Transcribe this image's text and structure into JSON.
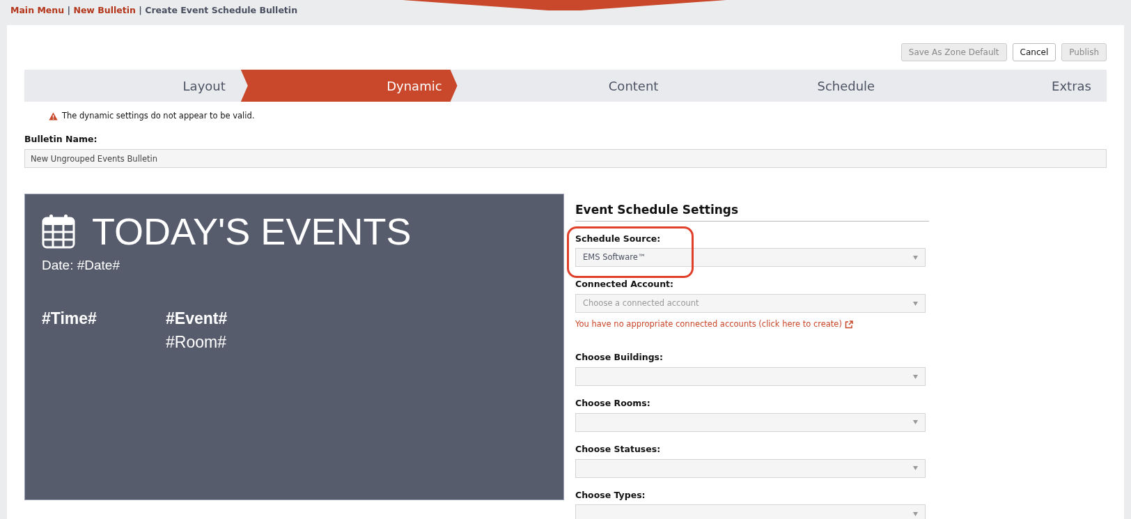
{
  "breadcrumb_separator": "|",
  "breadcrumb": [
    {
      "label": "Main Menu",
      "link": true
    },
    {
      "label": "New Bulletin",
      "link": true
    },
    {
      "label": "Create Event Schedule Bulletin",
      "link": false
    }
  ],
  "buttons": [
    {
      "label": "Save As Zone Default",
      "disabled": true
    },
    {
      "label": "Cancel",
      "disabled": false
    },
    {
      "label": "Publish",
      "disabled": true
    }
  ],
  "steps": [
    {
      "label": "Layout",
      "selected": false
    },
    {
      "label": "Dynamic",
      "selected": true
    },
    {
      "label": "Content",
      "selected": false
    },
    {
      "label": "Schedule",
      "selected": false
    },
    {
      "label": "Extras",
      "selected": false
    }
  ],
  "warning": "The dynamic settings do not appear to be valid.",
  "bulletin_name": {
    "label": "Bulletin Name:",
    "value": "New Ungrouped Events Bulletin"
  },
  "preview": {
    "title": "TODAY'S EVENTS",
    "date": "Date: #Date#",
    "time": "#Time#",
    "event": "#Event#",
    "room": "#Room#"
  },
  "settings": {
    "title": "Event Schedule Settings",
    "fields": [
      {
        "label": "Schedule Source:",
        "value": "EMS Software™",
        "highlighted": true
      },
      {
        "label": "Connected Account:",
        "placeholder": "Choose a connected account",
        "highlighted": false,
        "error": "You have no appropriate connected accounts (click here to create)"
      },
      {
        "label": "Choose Buildings:",
        "highlighted": false
      },
      {
        "label": "Choose Rooms:",
        "highlighted": false
      },
      {
        "label": "Choose Statuses:",
        "highlighted": false
      },
      {
        "label": "Choose Types:",
        "highlighted": false
      }
    ]
  }
}
